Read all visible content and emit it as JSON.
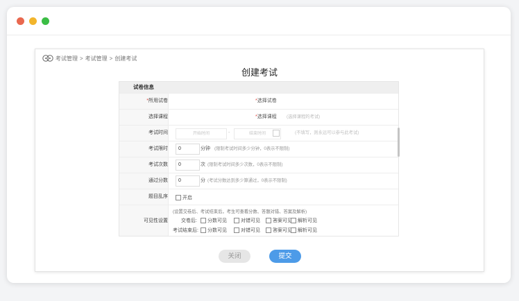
{
  "window": {
    "traffic_lights": [
      "close",
      "minimize",
      "maximize"
    ]
  },
  "breadcrumb": {
    "icon": "exam-home-icon",
    "items": [
      "考试管理",
      "考试管理",
      "创建考试"
    ],
    "separator": ">"
  },
  "page_title": "创建考试",
  "form": {
    "section_title": "试卷信息",
    "paper": {
      "label": "所用试卷",
      "select_label": "选择试卷"
    },
    "course": {
      "label": "选择课程",
      "select_label": "选择课程",
      "placeholder": "(选择课程的考试)"
    },
    "time": {
      "label": "考试时间",
      "start_placeholder": "开始时间",
      "end_placeholder": "结束时间",
      "separator": "-",
      "hint": "(不填写，则永远可以参与此考试)"
    },
    "duration": {
      "label": "考试限时",
      "value": "0",
      "unit": "分钟",
      "hint": "(限制考试时间多少分钟，0表示不限制)"
    },
    "attempts": {
      "label": "考试次数",
      "value": "0",
      "unit": "次",
      "hint": "(限制考试时间多少次数，0表示不限制)"
    },
    "pass_score": {
      "label": "通过分数",
      "value": "0",
      "unit": "分",
      "hint": "(考试分数达到多少算通过，0表示不限制)"
    },
    "shuffle": {
      "label": "题目乱序",
      "option": "开启"
    },
    "visibility": {
      "label": "可见性设置",
      "hint": "(设置交卷后、考试结束后，考生可查看分数、答题对错、答案及解析)",
      "after_submit": {
        "label": "交卷后:",
        "options": [
          "分数可见",
          "对错可见",
          "答案可见",
          "解析可见"
        ]
      },
      "after_end": {
        "label": "考试结束后:",
        "options": [
          "分数可见",
          "对错可见",
          "答案可见",
          "解析可见"
        ]
      }
    }
  },
  "buttons": {
    "close": "关闭",
    "submit": "提交"
  },
  "colors": {
    "submit": "#4d9be8",
    "required": "#e0443c",
    "close_dot": "#e9684f",
    "min_dot": "#f2b52c",
    "max_dot": "#3bbd45"
  }
}
